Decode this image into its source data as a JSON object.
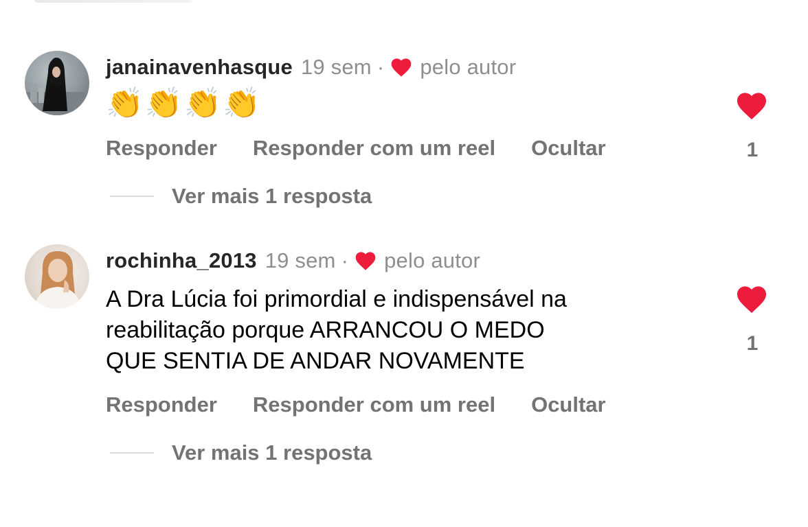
{
  "colors": {
    "heart": "#ed1c3c",
    "muted": "#737373",
    "username": "#262626"
  },
  "comments": [
    {
      "username": "janainavenhasque",
      "time": "19 sem",
      "separator": "·",
      "liked_by_author_label": "pelo autor",
      "text": "👏👏👏👏",
      "actions": {
        "reply": "Responder",
        "reply_reel": "Responder com um reel",
        "hide": "Ocultar"
      },
      "more_replies": "Ver mais 1 resposta",
      "like_count": "1",
      "avatar_icon": "profile-photo"
    },
    {
      "username": "rochinha_2013",
      "time": "19 sem",
      "separator": "·",
      "liked_by_author_label": "pelo autor",
      "text_lines": [
        "A Dra Lúcia foi primordial e indispensável na",
        "reabilitação porque ARRANCOU O MEDO",
        "QUE SENTIA DE ANDAR NOVAMENTE"
      ],
      "actions": {
        "reply": "Responder",
        "reply_reel": "Responder com um reel",
        "hide": "Ocultar"
      },
      "more_replies": "Ver mais 1 resposta",
      "like_count": "1",
      "avatar_icon": "profile-photo"
    }
  ]
}
